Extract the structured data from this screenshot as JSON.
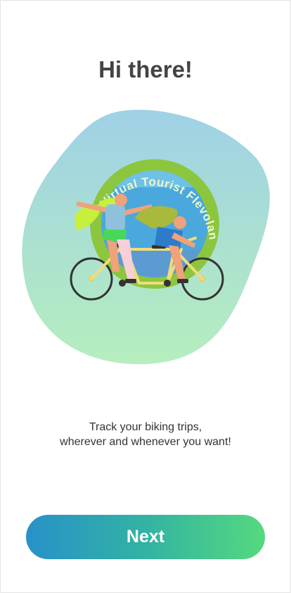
{
  "onboarding": {
    "title": "Hi there!",
    "logo_text": "Virtual Tourist Flevoland",
    "description_line1": "Track your biking trips,",
    "description_line2": "wherever and whenever you want!",
    "next_label": "Next"
  },
  "colors": {
    "blob_top": "#9fd1e6",
    "blob_bottom": "#b5ecbd",
    "badge_ring": "#8cc63f",
    "button_start": "#2891c9",
    "button_end": "#55d97e"
  }
}
